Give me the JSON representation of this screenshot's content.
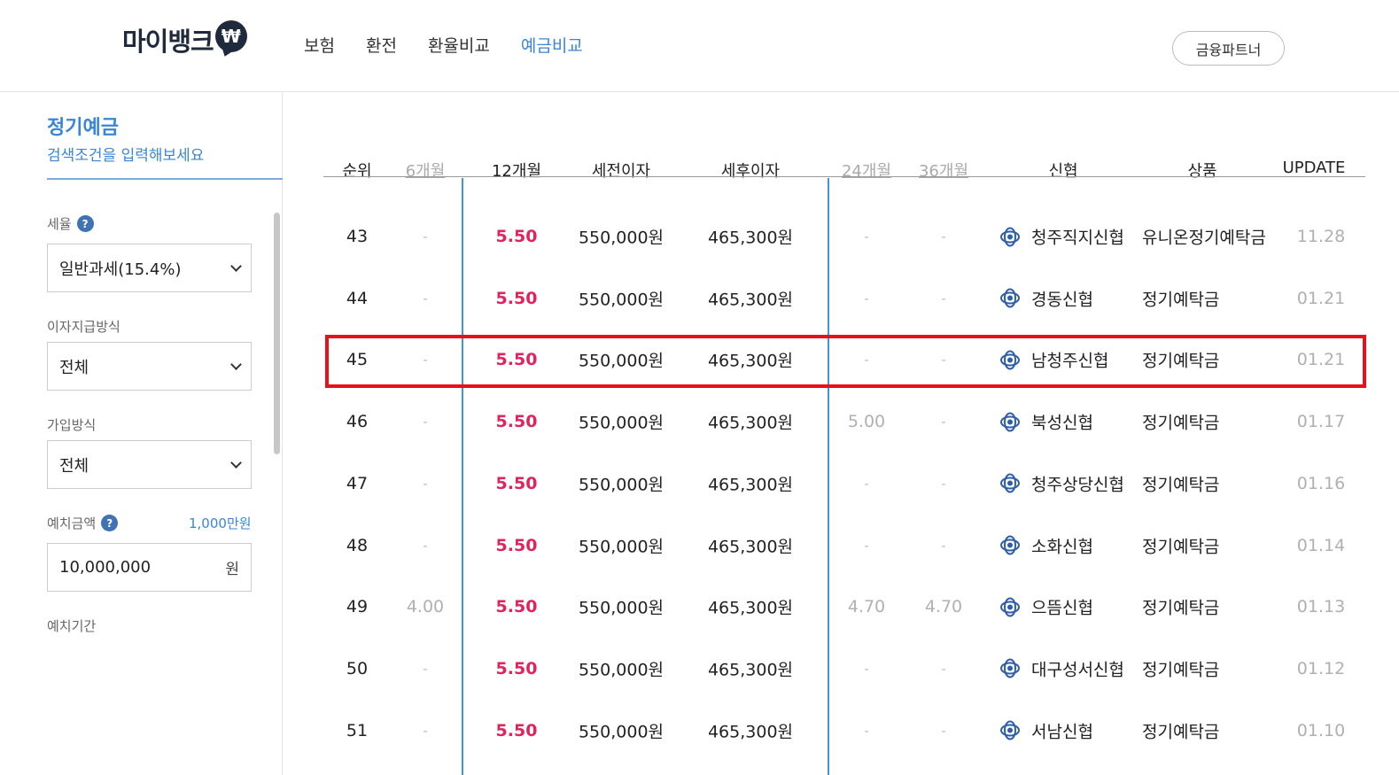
{
  "header": {
    "logo_text": "마이뱅크",
    "logo_badge": "₩",
    "nav": [
      "보험",
      "환전",
      "환율비교",
      "예금비교"
    ],
    "active_nav": "예금비교",
    "partner_button": "금융파트너"
  },
  "sidebar": {
    "title": "정기예금",
    "subtitle": "검색조건을 입력해보세요",
    "tax_label": "세율",
    "tax_value": "일반과세(15.4%)",
    "interest_label": "이자지급방식",
    "interest_value": "전체",
    "join_label": "가입방식",
    "join_value": "전체",
    "amount_label": "예치금액",
    "amount_note": "1,000만원",
    "amount_value": "10,000,000",
    "amount_unit": "원",
    "period_label": "예치기간",
    "help_glyph": "?"
  },
  "table": {
    "headers": {
      "rank": "순위",
      "m6": "6개월",
      "m12": "12개월",
      "pretax": "세전이자",
      "aftertax": "세후이자",
      "m24": "24개월",
      "m36": "36개월",
      "bank": "신협",
      "product": "상품",
      "update": "UPDATE"
    },
    "rows": [
      {
        "rank": "43",
        "m6": "-",
        "m12": "5.50",
        "pretax": "550,000원",
        "aftertax": "465,300원",
        "m24": "-",
        "m36": "-",
        "bank": "청주직지신협",
        "product": "유니온정기예탁금",
        "update": "11.28"
      },
      {
        "rank": "44",
        "m6": "-",
        "m12": "5.50",
        "pretax": "550,000원",
        "aftertax": "465,300원",
        "m24": "-",
        "m36": "-",
        "bank": "경동신협",
        "product": "정기예탁금",
        "update": "01.21"
      },
      {
        "rank": "45",
        "m6": "-",
        "m12": "5.50",
        "pretax": "550,000원",
        "aftertax": "465,300원",
        "m24": "-",
        "m36": "-",
        "bank": "남청주신협",
        "product": "정기예탁금",
        "update": "01.21"
      },
      {
        "rank": "46",
        "m6": "-",
        "m12": "5.50",
        "pretax": "550,000원",
        "aftertax": "465,300원",
        "m24": "5.00",
        "m36": "-",
        "bank": "북성신협",
        "product": "정기예탁금",
        "update": "01.17"
      },
      {
        "rank": "47",
        "m6": "-",
        "m12": "5.50",
        "pretax": "550,000원",
        "aftertax": "465,300원",
        "m24": "-",
        "m36": "-",
        "bank": "청주상당신협",
        "product": "정기예탁금",
        "update": "01.16"
      },
      {
        "rank": "48",
        "m6": "-",
        "m12": "5.50",
        "pretax": "550,000원",
        "aftertax": "465,300원",
        "m24": "-",
        "m36": "-",
        "bank": "소화신협",
        "product": "정기예탁금",
        "update": "01.14"
      },
      {
        "rank": "49",
        "m6": "4.00",
        "m12": "5.50",
        "pretax": "550,000원",
        "aftertax": "465,300원",
        "m24": "4.70",
        "m36": "4.70",
        "bank": "으뜸신협",
        "product": "정기예탁금",
        "update": "01.13"
      },
      {
        "rank": "50",
        "m6": "-",
        "m12": "5.50",
        "pretax": "550,000원",
        "aftertax": "465,300원",
        "m24": "-",
        "m36": "-",
        "bank": "대구성서신협",
        "product": "정기예탁금",
        "update": "01.12"
      },
      {
        "rank": "51",
        "m6": "-",
        "m12": "5.50",
        "pretax": "550,000원",
        "aftertax": "465,300원",
        "m24": "-",
        "m36": "-",
        "bank": "서남신협",
        "product": "정기예탁금",
        "update": "01.10"
      }
    ],
    "highlighted_rank": "45"
  },
  "colors": {
    "accent": "#3a86d6",
    "rate": "#e0245e",
    "highlight": "#e8101a",
    "bank_icon": "#2f5fa8"
  }
}
